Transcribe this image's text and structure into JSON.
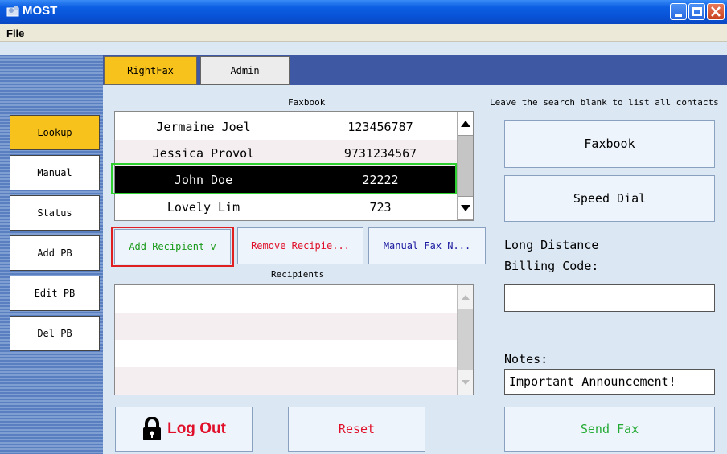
{
  "window": {
    "title": "MOST"
  },
  "menu": {
    "file": "File"
  },
  "tabs": [
    {
      "label": "RightFax"
    },
    {
      "label": "Admin"
    }
  ],
  "sidebar": {
    "items": [
      {
        "label": "Lookup"
      },
      {
        "label": "Manual"
      },
      {
        "label": "Status"
      },
      {
        "label": "Add PB"
      },
      {
        "label": "Edit PB"
      },
      {
        "label": "Del PB"
      }
    ]
  },
  "faxbook": {
    "label": "Faxbook",
    "rows": [
      {
        "name": "Jermaine Joel",
        "number": "123456787"
      },
      {
        "name": "Jessica Provol",
        "number": "9731234567"
      },
      {
        "name": "John Doe",
        "number": "22222"
      },
      {
        "name": "Lovely Lim",
        "number": "723"
      }
    ],
    "selected_index": 2
  },
  "actions": {
    "add_recipient": "Add Recipient v",
    "remove_recipient": "Remove Recipie...",
    "manual_fax": "Manual Fax N..."
  },
  "recipients": {
    "label": "Recipients"
  },
  "right_panel": {
    "search_hint": "Leave the search blank to list all contacts",
    "faxbook_button": "Faxbook",
    "speed_dial_button": "Speed Dial",
    "billing_label_line1": "Long Distance",
    "billing_label_line2": "Billing Code:",
    "billing_value": "",
    "notes_label": "Notes:",
    "notes_value": "Important Announcement!"
  },
  "bottom": {
    "logout": "Log Out",
    "reset": "Reset",
    "send_fax": "Send Fax"
  },
  "colors": {
    "active_tab": "#f7c21c",
    "selected_row": "#000000",
    "selected_outline": "#2fcf2f",
    "focus_outline": "#e02020",
    "add_text": "#1a9a1a",
    "remove_text": "#e0102a",
    "manual_text": "#1a1aa0",
    "logout_text": "#e0102a",
    "reset_text": "#e0102a",
    "send_text": "#22aa33"
  },
  "icons": {
    "app": "app-icon",
    "lock": "lock-icon",
    "scroll_up": "scroll-up-arrow-icon",
    "scroll_down": "scroll-down-arrow-icon"
  }
}
